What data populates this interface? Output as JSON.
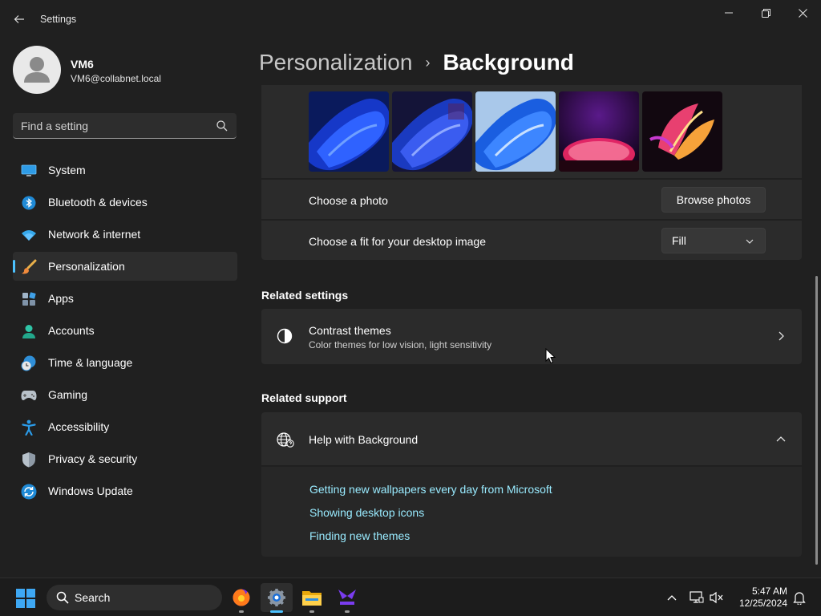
{
  "window": {
    "title": "Settings"
  },
  "user": {
    "name": "VM6",
    "email": "VM6@collabnet.local"
  },
  "search": {
    "placeholder": "Find a setting"
  },
  "nav": [
    {
      "label": "System",
      "icon": "system-icon"
    },
    {
      "label": "Bluetooth & devices",
      "icon": "bluetooth-icon"
    },
    {
      "label": "Network & internet",
      "icon": "wifi-icon"
    },
    {
      "label": "Personalization",
      "icon": "brush-icon",
      "selected": true
    },
    {
      "label": "Apps",
      "icon": "apps-icon"
    },
    {
      "label": "Accounts",
      "icon": "accounts-icon"
    },
    {
      "label": "Time & language",
      "icon": "clock-globe-icon"
    },
    {
      "label": "Gaming",
      "icon": "gamepad-icon"
    },
    {
      "label": "Accessibility",
      "icon": "accessibility-icon"
    },
    {
      "label": "Privacy & security",
      "icon": "shield-icon"
    },
    {
      "label": "Windows Update",
      "icon": "update-icon"
    }
  ],
  "breadcrumb": {
    "parent": "Personalization",
    "separator": "›",
    "current": "Background"
  },
  "background": {
    "choose_photo_label": "Choose a photo",
    "browse_button": "Browse photos",
    "fit_label": "Choose a fit for your desktop image",
    "fit_value": "Fill"
  },
  "related_settings": {
    "title": "Related settings",
    "contrast_title": "Contrast themes",
    "contrast_subtitle": "Color themes for low vision, light sensitivity"
  },
  "related_support": {
    "title": "Related support",
    "help_title": "Help with Background",
    "links": [
      "Getting new wallpapers every day from Microsoft",
      "Showing desktop icons",
      "Finding new themes"
    ]
  },
  "taskbar": {
    "search_label": "Search",
    "time": "5:47 AM",
    "date": "12/25/2024"
  },
  "colors": {
    "accent": "#4cc2ff",
    "link": "#99ebff",
    "background": "#202020",
    "card": "#2b2b2b"
  }
}
